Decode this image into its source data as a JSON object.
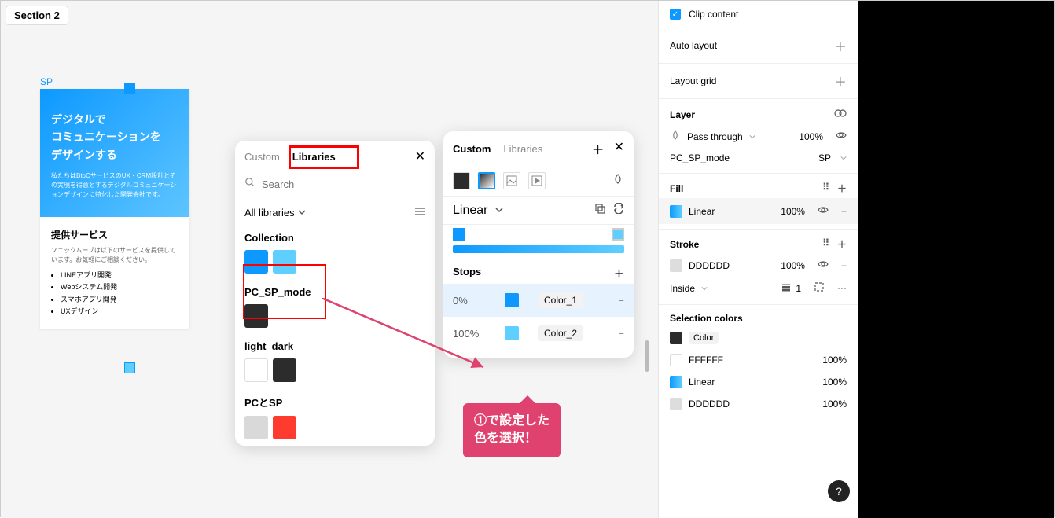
{
  "section": {
    "tag": "Section 2"
  },
  "frame": {
    "label": "SP",
    "hero_title_l1": "デジタルで",
    "hero_title_l2": "コミュニケーションを",
    "hero_title_l3": "デザインする",
    "hero_desc": "私たちはBtoCサービスのUX・CRM設計とその実現を得意とするデジタルコミュニケーションデザインに特化した開発会社です。",
    "body_title": "提供サービス",
    "body_desc": "ソニックムーブは以下のサービスを提供しています。お気軽にご相談ください。",
    "services": [
      "LINEアプリ開発",
      "Webシステム開発",
      "スマホアプリ開発",
      "UXデザイン"
    ]
  },
  "libs_panel": {
    "tab_custom": "Custom",
    "tab_libraries": "Libraries",
    "search_placeholder": "Search",
    "filter_label": "All libraries",
    "sections": [
      {
        "title": "Collection",
        "swatches": [
          "#0d99ff",
          "#5ecfff"
        ]
      },
      {
        "title": "PC_SP_mode",
        "swatches": [
          "#2c2c2c"
        ]
      },
      {
        "title": "light_dark",
        "swatches": [
          "#ffffff",
          "#2c2c2c"
        ]
      },
      {
        "title": "PCとSP",
        "swatches": [
          "#d9d9d9",
          "#ff3b30"
        ]
      }
    ]
  },
  "gradient_panel": {
    "tab_custom": "Custom",
    "tab_libraries": "Libraries",
    "type": "Linear",
    "stops_title": "Stops",
    "stops": [
      {
        "pct": "0%",
        "color": "#0d99ff",
        "name": "Color_1",
        "selected": true
      },
      {
        "pct": "100%",
        "color": "#5ecfff",
        "name": "Color_2",
        "selected": false
      }
    ]
  },
  "callout": {
    "line1": "①で設定した",
    "line2": "色を選択！"
  },
  "right_panel": {
    "clip_content": "Clip content",
    "auto_layout": "Auto layout",
    "layout_grid": "Layout grid",
    "layer": "Layer",
    "blend_mode": "Pass through",
    "opacity": "100%",
    "var_mode_label": "PC_SP_mode",
    "var_mode_value": "SP",
    "fill_title": "Fill",
    "fill_type": "Linear",
    "fill_opacity": "100%",
    "stroke_title": "Stroke",
    "stroke_color": "DDDDDD",
    "stroke_opacity": "100%",
    "stroke_position": "Inside",
    "stroke_width": "1",
    "selection_title": "Selection colors",
    "sel_colors": [
      {
        "sw": "#2c2c2c",
        "name": "Color",
        "opacity": ""
      },
      {
        "sw": "#ffffff",
        "name": "FFFFFF",
        "opacity": "100%"
      },
      {
        "sw": "#0d99ff",
        "name": "Linear",
        "opacity": "100%"
      },
      {
        "sw": "#dddddd",
        "name": "DDDDDD",
        "opacity": "100%"
      }
    ]
  }
}
